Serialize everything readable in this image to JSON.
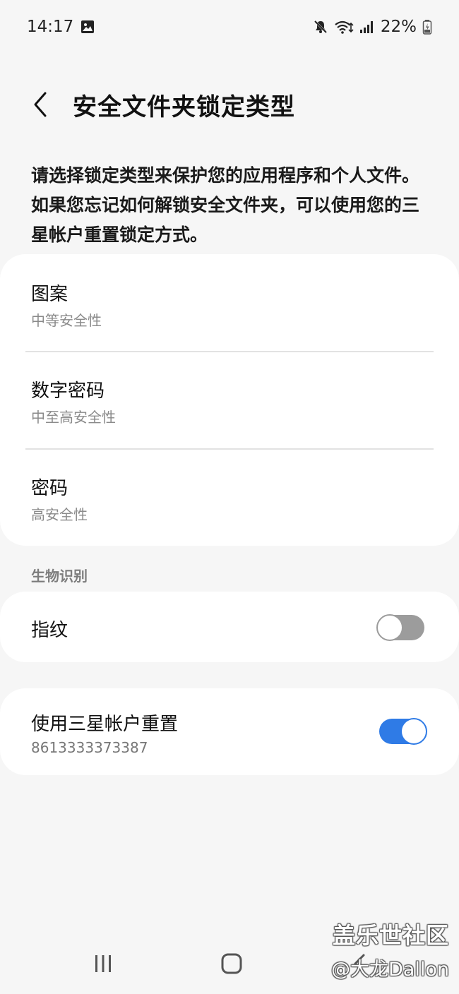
{
  "status_bar": {
    "time": "14:17",
    "battery": "22%",
    "icons": [
      "gallery-icon",
      "mute-icon",
      "wifi-icon",
      "signal-icon",
      "battery-icon"
    ]
  },
  "header": {
    "title": "安全文件夹锁定类型",
    "back_icon": "chevron-left-icon"
  },
  "description": "请选择锁定类型来保护您的应用程序和个人文件。如果您忘记如何解锁安全文件夹，可以使用您的三星帐户重置锁定方式。",
  "lock_types": [
    {
      "title": "图案",
      "subtitle": "中等安全性"
    },
    {
      "title": "数字密码",
      "subtitle": "中至高安全性"
    },
    {
      "title": "密码",
      "subtitle": "高安全性"
    }
  ],
  "biometrics": {
    "section_title": "生物识别",
    "fingerprint": {
      "title": "指纹",
      "enabled": false
    }
  },
  "samsung_reset": {
    "title": "使用三星帐户重置",
    "subtitle": "8613333373387",
    "enabled": true
  },
  "nav_bar": {
    "icons": [
      "recents-icon",
      "home-icon",
      "back-icon"
    ]
  },
  "watermark": {
    "line1": "盖乐世社区",
    "line2": "@大龙Dallon"
  },
  "colors": {
    "background": "#f6f6f6",
    "card": "#ffffff",
    "accent": "#2f7be6",
    "toggle_off": "#9c9c9c"
  }
}
